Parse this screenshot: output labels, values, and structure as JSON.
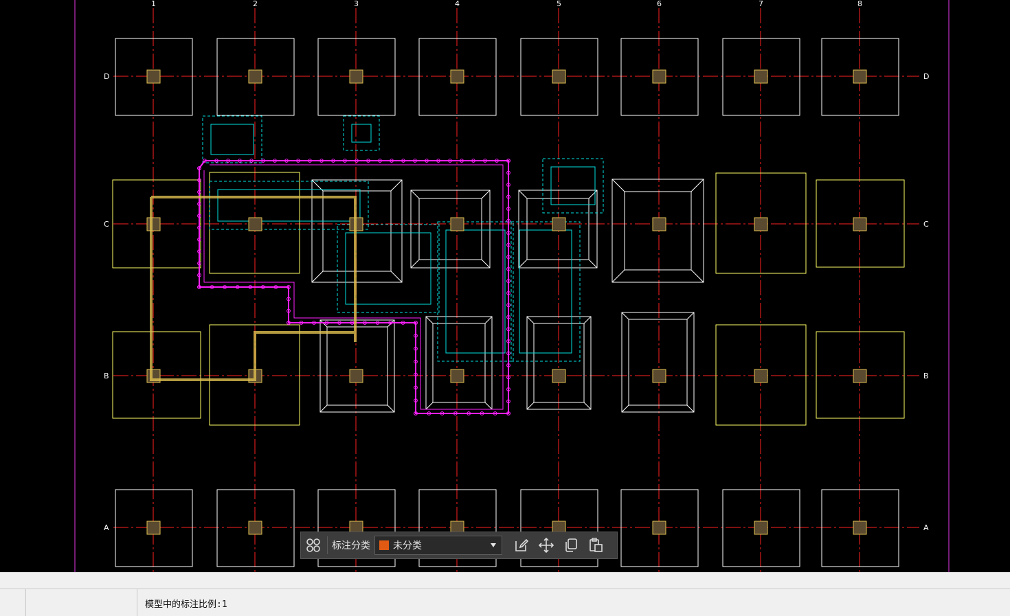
{
  "drawing": {
    "column_labels": [
      "1",
      "2",
      "3",
      "4",
      "5",
      "6",
      "7",
      "8"
    ],
    "row_labels": [
      "D",
      "C",
      "B",
      "A"
    ],
    "colors": {
      "background": "#000000",
      "axis": "#ff2020",
      "footing": "#ffffff",
      "footing_alt": "#ffff66",
      "column": "#e0c050",
      "dashed": "#00e0e0",
      "pile": "#ff20ff",
      "frame": "#c030c0"
    }
  },
  "toolbar": {
    "category_label": "标注分类",
    "selected_category": "未分类",
    "selected_color": "#e05a14",
    "icons": [
      "grid-view-icon",
      "edit-icon",
      "move-icon",
      "copy-icon",
      "paste-icon"
    ]
  },
  "status": {
    "scale_text": "模型中的标注比例:1"
  }
}
